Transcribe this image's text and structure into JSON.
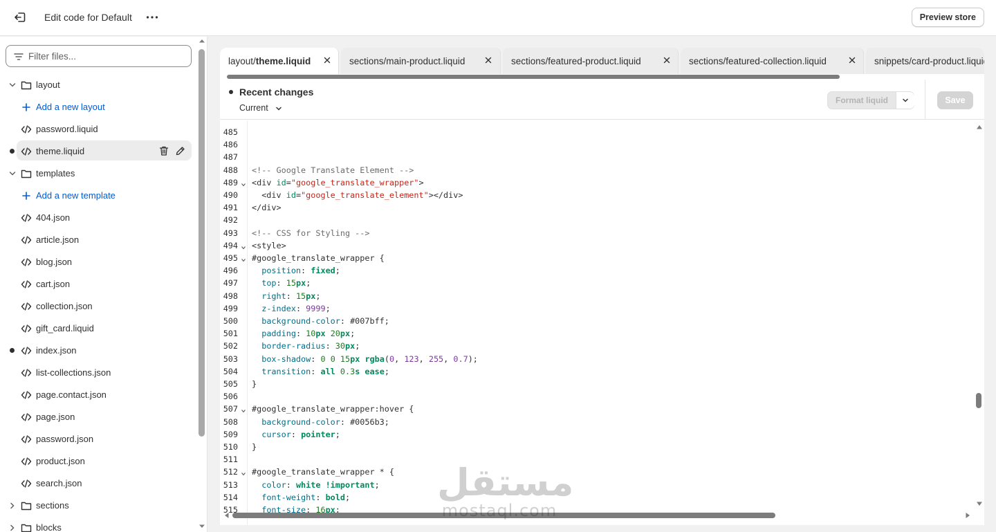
{
  "header": {
    "title": "Edit code for Default",
    "preview_label": "Preview store"
  },
  "sidebar": {
    "filter_placeholder": "Filter files...",
    "items": [
      {
        "type": "folder",
        "label": "layout",
        "expanded": true
      },
      {
        "type": "add",
        "label": "Add a new layout"
      },
      {
        "type": "file",
        "label": "password.liquid"
      },
      {
        "type": "file",
        "label": "theme.liquid",
        "selected": true,
        "modified": true
      },
      {
        "type": "folder",
        "label": "templates",
        "expanded": true
      },
      {
        "type": "add",
        "label": "Add a new template"
      },
      {
        "type": "file",
        "label": "404.json"
      },
      {
        "type": "file",
        "label": "article.json"
      },
      {
        "type": "file",
        "label": "blog.json"
      },
      {
        "type": "file",
        "label": "cart.json"
      },
      {
        "type": "file",
        "label": "collection.json"
      },
      {
        "type": "file",
        "label": "gift_card.liquid"
      },
      {
        "type": "file",
        "label": "index.json",
        "modified": true
      },
      {
        "type": "file",
        "label": "list-collections.json"
      },
      {
        "type": "file",
        "label": "page.contact.json"
      },
      {
        "type": "file",
        "label": "page.json"
      },
      {
        "type": "file",
        "label": "password.json"
      },
      {
        "type": "file",
        "label": "product.json"
      },
      {
        "type": "file",
        "label": "search.json"
      },
      {
        "type": "folder",
        "label": "sections",
        "expanded": false
      },
      {
        "type": "folder",
        "label": "blocks",
        "expanded": false
      }
    ]
  },
  "tabs": [
    {
      "prefix": "layout/",
      "name": "theme.liquid",
      "active": true
    },
    {
      "prefix": "",
      "name": "sections/main-product.liquid",
      "active": false
    },
    {
      "prefix": "",
      "name": "sections/featured-product.liquid",
      "active": false
    },
    {
      "prefix": "",
      "name": "sections/featured-collection.liquid",
      "active": false
    },
    {
      "prefix": "",
      "name": "snippets/card-product.liquid",
      "active": false
    }
  ],
  "changes": {
    "title": "Recent changes",
    "version": "Current",
    "format_label": "Format liquid",
    "save_label": "Save"
  },
  "code": {
    "lines": [
      {
        "n": "485",
        "t": ""
      },
      {
        "n": "486",
        "t": ""
      },
      {
        "n": "487",
        "t": ""
      },
      {
        "n": "488",
        "t": "<!-- Google Translate Element -->"
      },
      {
        "n": "489",
        "t": "<div id=\"google_translate_wrapper\">",
        "fold": true
      },
      {
        "n": "490",
        "t": "  <div id=\"google_translate_element\"></div>"
      },
      {
        "n": "491",
        "t": "</div>"
      },
      {
        "n": "492",
        "t": ""
      },
      {
        "n": "493",
        "t": "<!-- CSS for Styling -->"
      },
      {
        "n": "494",
        "t": "<style>",
        "fold": true
      },
      {
        "n": "495",
        "t": "#google_translate_wrapper {",
        "fold": true
      },
      {
        "n": "496",
        "t": "  position: fixed;"
      },
      {
        "n": "497",
        "t": "  top: 15px;"
      },
      {
        "n": "498",
        "t": "  right: 15px;"
      },
      {
        "n": "499",
        "t": "  z-index: 9999;"
      },
      {
        "n": "500",
        "t": "  background-color: #007bff;"
      },
      {
        "n": "501",
        "t": "  padding: 10px 20px;"
      },
      {
        "n": "502",
        "t": "  border-radius: 30px;"
      },
      {
        "n": "503",
        "t": "  box-shadow: 0 0 15px rgba(0, 123, 255, 0.7);"
      },
      {
        "n": "504",
        "t": "  transition: all 0.3s ease;"
      },
      {
        "n": "505",
        "t": "}"
      },
      {
        "n": "506",
        "t": ""
      },
      {
        "n": "507",
        "t": "#google_translate_wrapper:hover {",
        "fold": true
      },
      {
        "n": "508",
        "t": "  background-color: #0056b3;"
      },
      {
        "n": "509",
        "t": "  cursor: pointer;"
      },
      {
        "n": "510",
        "t": "}"
      },
      {
        "n": "511",
        "t": ""
      },
      {
        "n": "512",
        "t": "#google_translate_wrapper * {",
        "fold": true
      },
      {
        "n": "513",
        "t": "  color: white !important;"
      },
      {
        "n": "514",
        "t": "  font-weight: bold;"
      },
      {
        "n": "515",
        "t": "  font-size: 16px;"
      }
    ]
  },
  "watermark": {
    "arabic": "مستقل",
    "latin": "mostaql.com"
  }
}
